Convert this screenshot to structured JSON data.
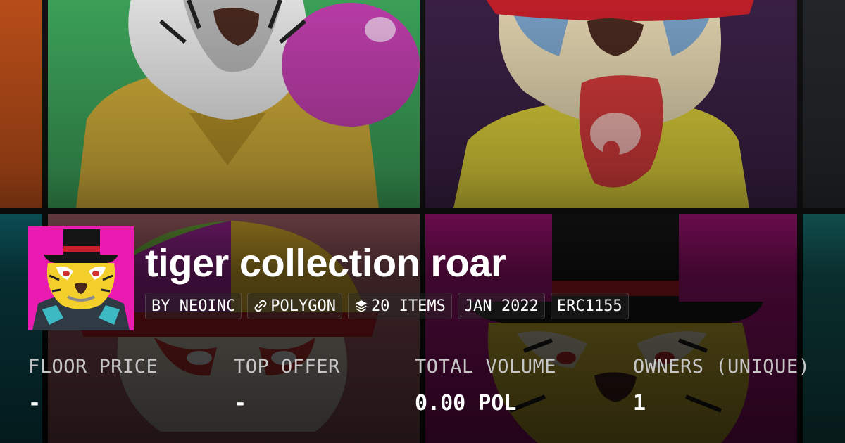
{
  "collection": {
    "title": "tiger collection roar"
  },
  "chips": [
    {
      "label": "BY NEOINC",
      "icon": ""
    },
    {
      "label": "POLYGON",
      "icon": "chain-link-icon"
    },
    {
      "label": "20 ITEMS",
      "icon": "layers-icon"
    },
    {
      "label": "JAN 2022",
      "icon": ""
    },
    {
      "label": "ERC1155",
      "icon": ""
    }
  ],
  "stats": [
    {
      "label": "FLOOR PRICE",
      "value": "-"
    },
    {
      "label": "TOP OFFER",
      "value": "-"
    },
    {
      "label": "TOTAL VOLUME",
      "value": "0.00 POL"
    },
    {
      "label": "OWNERS (UNIQUE)",
      "value": "1"
    }
  ],
  "colors": {
    "avatar_background": "#ea1bb0",
    "tile_green": "#3ea85c",
    "tile_purple": "#3b2146",
    "tile_rose": "#b46a72",
    "tile_magenta": "#c2168e",
    "tile_orange": "#c1511a",
    "tile_teal": "#138e9a"
  }
}
